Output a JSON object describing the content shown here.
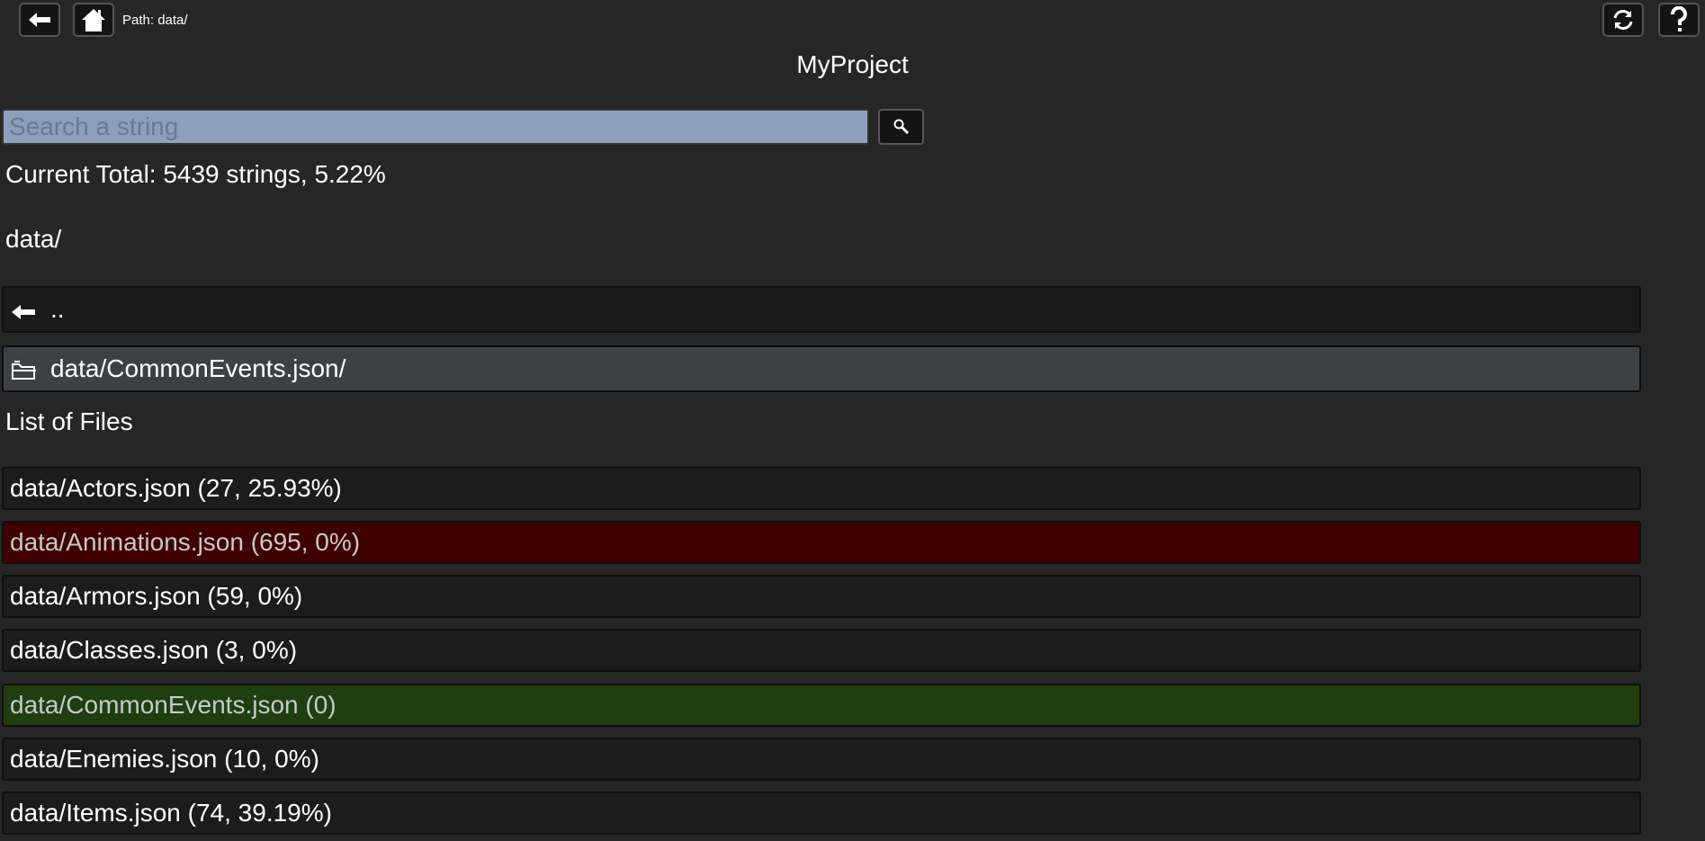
{
  "topbar": {
    "path_text": "Path: data/"
  },
  "project": {
    "title": "MyProject"
  },
  "search": {
    "placeholder": "Search a string"
  },
  "summary": {
    "total": "Current Total: 5439 strings, 5.22%"
  },
  "current_path": "data/",
  "nav": {
    "up_label": "..",
    "folder_label": "data/CommonEvents.json/"
  },
  "files_heading": "List of Files",
  "files": [
    {
      "label": "data/Actors.json (27, 25.93%)",
      "status": "normal"
    },
    {
      "label": "data/Animations.json (695, 0%)",
      "status": "red"
    },
    {
      "label": "data/Armors.json (59, 0%)",
      "status": "normal"
    },
    {
      "label": "data/Classes.json (3, 0%)",
      "status": "normal"
    },
    {
      "label": "data/CommonEvents.json (0)",
      "status": "green"
    },
    {
      "label": "data/Enemies.json (10, 0%)",
      "status": "normal"
    },
    {
      "label": "data/Items.json (74, 39.19%)",
      "status": "normal"
    }
  ],
  "icons": {
    "back": "arrow-left-icon",
    "home": "home-icon",
    "refresh": "refresh-icon",
    "help": "help-icon",
    "search": "magnifier-icon",
    "up": "arrow-left-icon",
    "folder": "folder-icon"
  },
  "colors": {
    "background": "#262626",
    "row": "#1c1c1c",
    "row_red": "#3f0000",
    "row_green": "#203f10",
    "folder_row": "#3a4246",
    "search_field": "#8e9fbe"
  }
}
